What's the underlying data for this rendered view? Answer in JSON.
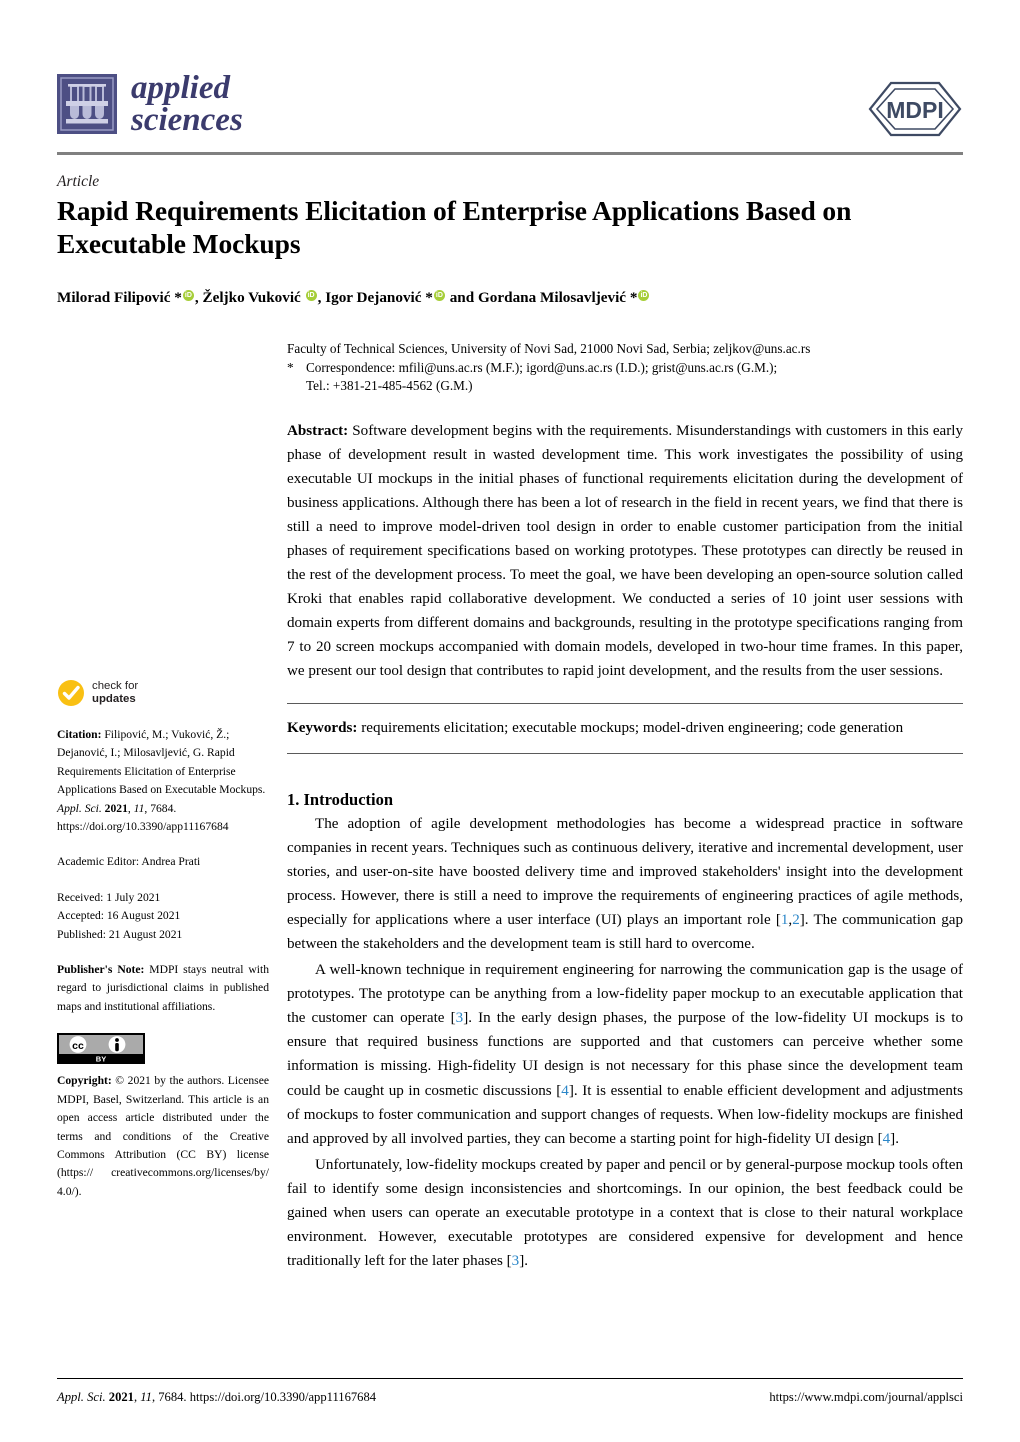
{
  "journal": {
    "name_line1": "applied",
    "name_line2": "sciences",
    "publisher_mark": "MDPI",
    "logo_icon": "test-tube-rack-icon",
    "brand_color": "#3b3b6d",
    "icon_bg_color": "#4d4f84"
  },
  "article": {
    "type": "Article",
    "title": "Rapid Requirements Elicitation of Enterprise Applications Based on Executable Mockups",
    "authors_html": "Milorad Filipović *{orcid}, Željko Vuković {orcid}, Igor Dejanović *{orcid} and Gordana Milosavljević *{orcid}",
    "orcid_icon": "orcid-id-icon",
    "orcid_color": "#a6ce39"
  },
  "affiliation": {
    "line1": "Faculty of Technical Sciences, University of Novi Sad, 21000 Novi Sad, Serbia; zeljkov@uns.ac.rs",
    "star": "*",
    "correspondence_line1": "Correspondence: mfili@uns.ac.rs (M.F.); igord@uns.ac.rs (I.D.); grist@uns.ac.rs (G.M.);",
    "correspondence_line2": "Tel.: +381-21-485-4562 (G.M.)"
  },
  "abstract": {
    "label": "Abstract:",
    "text": "Software development begins with the requirements. Misunderstandings with customers in this early phase of development result in wasted development time. This work investigates the possibility of using executable UI mockups in the initial phases of functional requirements elicitation during the development of business applications. Although there has been a lot of research in the field in recent years, we find that there is still a need to improve model-driven tool design in order to enable customer participation from the initial phases of requirement specifications based on working prototypes. These prototypes can directly be reused in the rest of the development process. To meet the goal, we have been developing an open-source solution called Kroki that enables rapid collaborative development. We conducted a series of 10 joint user sessions with domain experts from different domains and backgrounds, resulting in the prototype specifications ranging from 7 to 20 screen mockups accompanied with domain models, developed in two-hour time frames. In this paper, we present our tool design that contributes to rapid joint development, and the results from the user sessions."
  },
  "keywords": {
    "label": "Keywords:",
    "text": "requirements elicitation; executable mockups; model-driven engineering; code generation"
  },
  "sections": {
    "intro_heading": "1. Introduction",
    "intro_p1": "The adoption of agile development methodologies has become a widespread practice in software companies in recent years. Techniques such as continuous delivery, iterative and incremental development, user stories, and user-on-site have boosted delivery time and improved stakeholders' insight into the development process. However, there is still a need to improve the requirements of engineering practices of agile methods, especially for applications where a user interface (UI) plays an important role [{cite:1,2}]. The communication gap between the stakeholders and the development team is still hard to overcome.",
    "intro_p2": "A well-known technique in requirement engineering for narrowing the communication gap is the usage of prototypes. The prototype can be anything from a low-fidelity paper mockup to an executable application that the customer can operate [{cite:3}]. In the early design phases, the purpose of the low-fidelity UI mockups is to ensure that required business functions are supported and that customers can perceive whether some information is missing. High-fidelity UI design is not necessary for this phase since the development team could be caught up in cosmetic discussions [{cite:4}]. It is essential to enable efficient development and adjustments of mockups to foster communication and support changes of requests. When low-fidelity mockups are finished and approved by all involved parties, they can become a starting point for high-fidelity UI design [{cite:4}].",
    "intro_p3": "Unfortunately, low-fidelity mockups created by paper and pencil or by general-purpose mockup tools often fail to identify some design inconsistencies and shortcomings. In our opinion, the best feedback could be gained when users can operate an executable prototype in a context that is close to their natural workplace environment. However, executable prototypes are considered expensive for development and hence traditionally left for the later phases [{cite:3}]."
  },
  "sidebar": {
    "check_updates_line1": "check for",
    "check_updates_line2": "updates",
    "check_updates_icon": "check-circle-icon",
    "check_updates_color": "#f9c013",
    "citation_label": "Citation:",
    "citation_text": "Filipović, M.; Vuković, Ž.; Dejanović, I.; Milosavljević, G. Rapid Requirements Elicitation of Enterprise Applications Based on Executable Mockups.",
    "citation_journal": "Appl. Sci.",
    "citation_year": "2021",
    "citation_volume": "11",
    "citation_pages": "7684.",
    "citation_doi": "https://doi.org/10.3390/app11167684",
    "academic_editor": "Academic Editor: Andrea Prati",
    "received": "Received: 1 July 2021",
    "accepted": "Accepted: 16 August 2021",
    "published": "Published: 21 August 2021",
    "publisher_note_label": "Publisher's Note:",
    "publisher_note_text": "MDPI stays neutral with regard to jurisdictional claims in published maps and institutional affiliations.",
    "cc_badge_icon": "creative-commons-by-icon",
    "cc_badge_label": "BY",
    "copyright_label": "Copyright:",
    "copyright_text": "© 2021 by the authors. Licensee MDPI, Basel, Switzerland. This article is an open access article distributed under the terms and conditions of the Creative Commons Attribution (CC BY) license (https:// creativecommons.org/licenses/by/ 4.0/)."
  },
  "footer": {
    "left_journal": "Appl. Sci.",
    "left_year": "2021",
    "left_volume": "11",
    "left_pages": "7684.",
    "left_doi": "https://doi.org/10.3390/app11167684",
    "right_url": "https://www.mdpi.com/journal/applsci"
  }
}
